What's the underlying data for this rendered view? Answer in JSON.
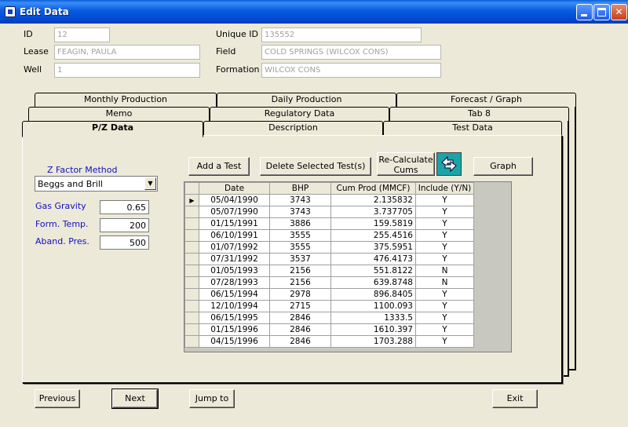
{
  "window": {
    "title": "Edit Data",
    "minimize_label": "",
    "maximize_label": "",
    "close_label": "✕"
  },
  "header": {
    "id_label": "ID",
    "id_value": "12",
    "lease_label": "Lease",
    "lease_value": "FEAGIN, PAULA",
    "well_label": "Well",
    "well_value": "1",
    "unique_id_label": "Unique ID",
    "unique_id_value": "135552",
    "field_label": "Field",
    "field_value": "COLD SPRINGS (WILCOX CONS)",
    "formation_label": "Formation",
    "formation_value": "WILCOX CONS"
  },
  "tabs": {
    "monthly_production": "Monthly Production",
    "daily_production": "Daily Production",
    "forecast_graph": "Forecast / Graph",
    "memo": "Memo",
    "regulatory_data": "Regulatory Data",
    "tab8": "Tab 8",
    "pz_data": "P/Z Data",
    "description": "Description",
    "test_data": "Test Data"
  },
  "pz": {
    "z_factor_label": "Z Factor Method",
    "z_factor_value": "Beggs and Brill",
    "gas_gravity_label": "Gas Gravity",
    "gas_gravity_value": "0.65",
    "form_temp_label": "Form. Temp.",
    "form_temp_value": "200",
    "aband_pres_label": "Aband. Pres.",
    "aband_pres_value": "500",
    "add_test": "Add a Test",
    "delete_tests": "Delete Selected Test(s)",
    "recalc_line1": "Re-Calculate",
    "recalc_line2": "Cums",
    "graph": "Graph",
    "columns": [
      "Date",
      "BHP",
      "Cum Prod (MMCF)",
      "Include (Y/N)"
    ],
    "rows": [
      [
        "05/04/1990",
        "3743",
        "2.135832",
        "Y"
      ],
      [
        "05/07/1990",
        "3743",
        "3.737705",
        "Y"
      ],
      [
        "01/15/1991",
        "3886",
        "159.5819",
        "Y"
      ],
      [
        "06/10/1991",
        "3555",
        "255.4516",
        "Y"
      ],
      [
        "01/07/1992",
        "3555",
        "375.5951",
        "Y"
      ],
      [
        "07/31/1992",
        "3537",
        "476.4173",
        "Y"
      ],
      [
        "01/05/1993",
        "2156",
        "551.8122",
        "N"
      ],
      [
        "07/28/1993",
        "2156",
        "639.8748",
        "N"
      ],
      [
        "06/15/1994",
        "2978",
        "896.8405",
        "Y"
      ],
      [
        "12/10/1994",
        "2715",
        "1100.093",
        "Y"
      ],
      [
        "06/15/1995",
        "2846",
        "1333.5",
        "Y"
      ],
      [
        "01/15/1996",
        "2846",
        "1610.397",
        "Y"
      ],
      [
        "04/15/1996",
        "2846",
        "1703.288",
        "Y"
      ]
    ],
    "current_row_marker": "▶"
  },
  "footer": {
    "previous": "Previous",
    "next": "Next",
    "jump_to": "Jump to",
    "exit": "Exit"
  }
}
